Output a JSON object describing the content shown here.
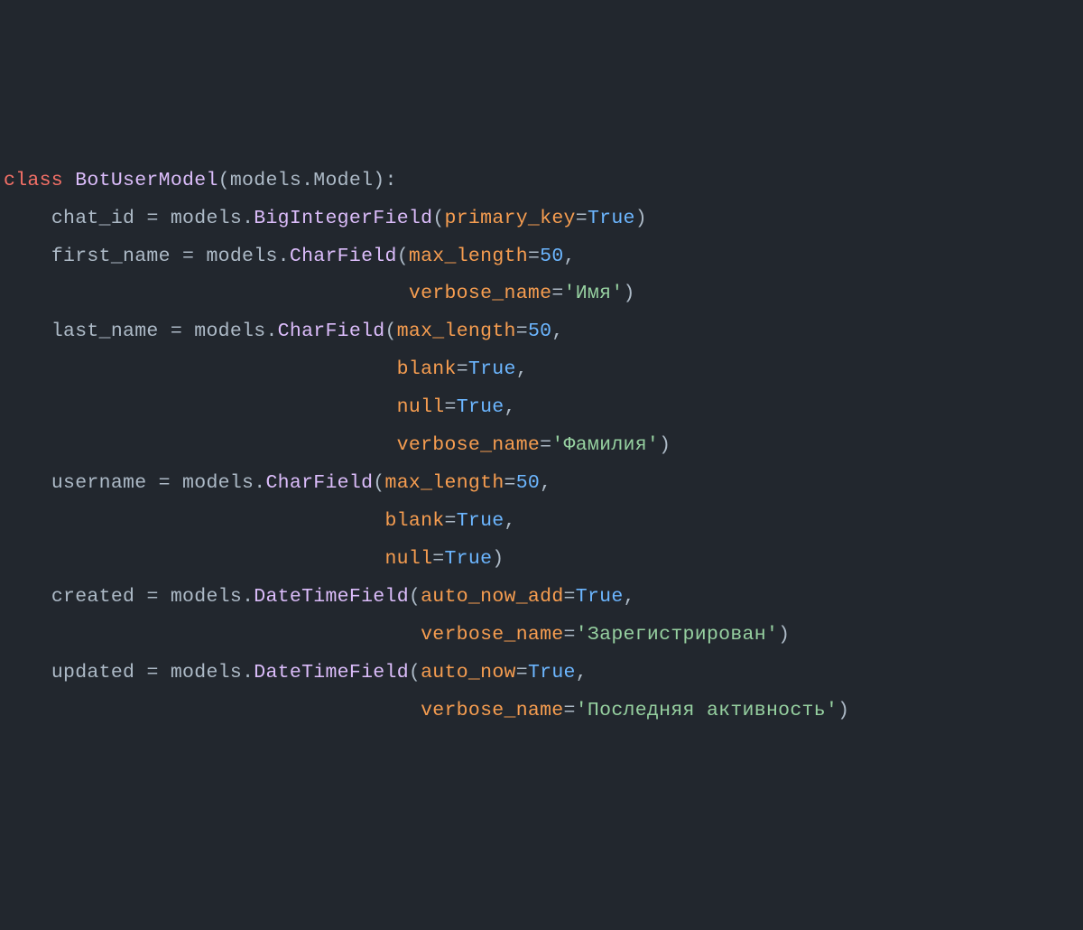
{
  "code": {
    "keyword_class": "class",
    "class_name": "BotUserModel",
    "base_module": "models",
    "base_class": "Model",
    "fields": {
      "chat_id": {
        "name": "chat_id",
        "module": "models",
        "call": "BigIntegerField",
        "primary_key_param": "primary_key",
        "primary_key_value": "True"
      },
      "first_name": {
        "name": "first_name",
        "module": "models",
        "call": "CharField",
        "max_length_param": "max_length",
        "max_length_value": "50",
        "verbose_name_param": "verbose_name",
        "verbose_name_value": "'Имя'"
      },
      "last_name": {
        "name": "last_name",
        "module": "models",
        "call": "CharField",
        "max_length_param": "max_length",
        "max_length_value": "50",
        "blank_param": "blank",
        "blank_value": "True",
        "null_param": "null",
        "null_value": "True",
        "verbose_name_param": "verbose_name",
        "verbose_name_value": "'Фамилия'"
      },
      "username": {
        "name": "username",
        "module": "models",
        "call": "CharField",
        "max_length_param": "max_length",
        "max_length_value": "50",
        "blank_param": "blank",
        "blank_value": "True",
        "null_param": "null",
        "null_value": "True"
      },
      "created": {
        "name": "created",
        "module": "models",
        "call": "DateTimeField",
        "auto_now_add_param": "auto_now_add",
        "auto_now_add_value": "True",
        "verbose_name_param": "verbose_name",
        "verbose_name_value": "'Зарегистрирован'"
      },
      "updated": {
        "name": "updated",
        "module": "models",
        "call": "DateTimeField",
        "auto_now_param": "auto_now",
        "auto_now_value": "True",
        "verbose_name_param": "verbose_name",
        "verbose_name_value": "'Последняя активность'"
      }
    }
  }
}
